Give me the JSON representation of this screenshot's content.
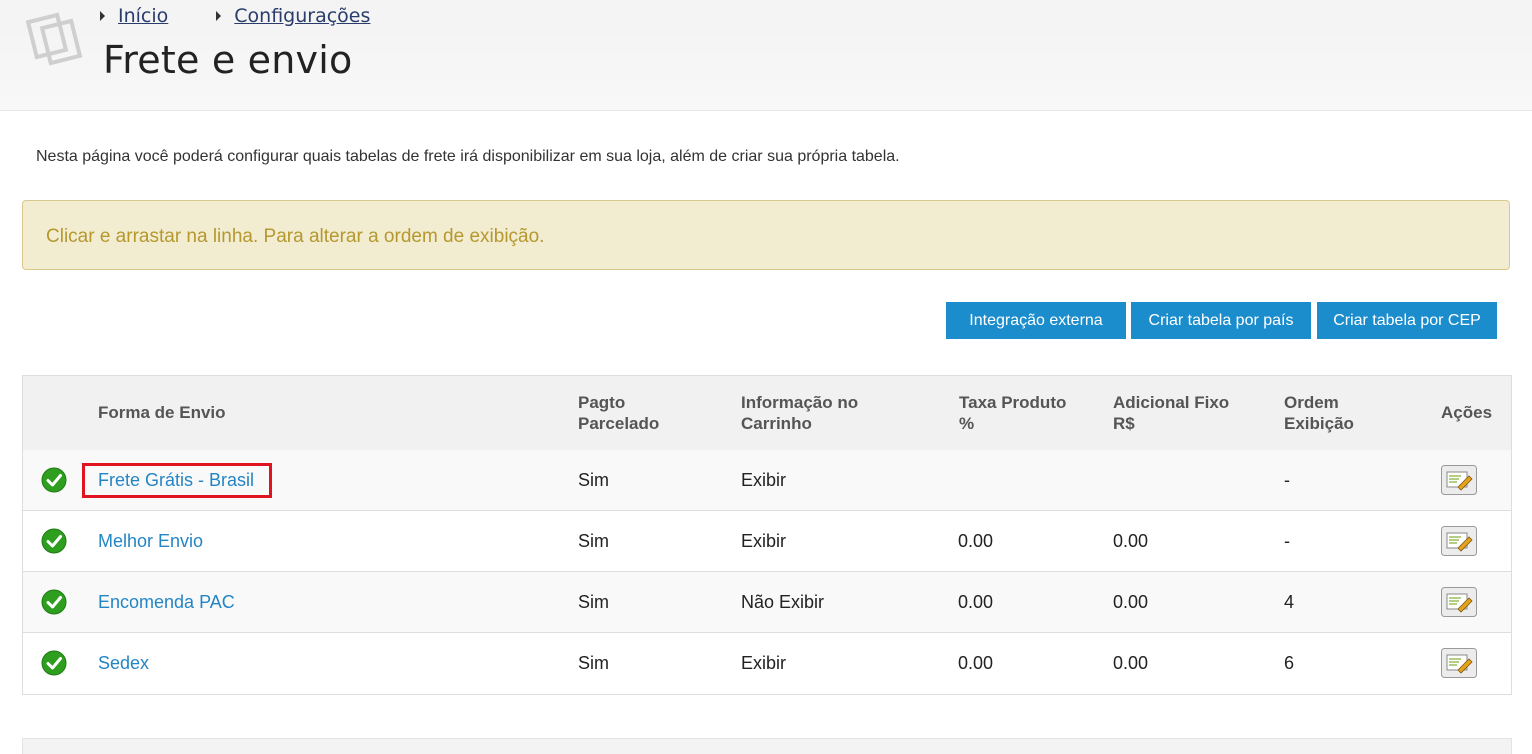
{
  "breadcrumb": [
    {
      "label": "Início"
    },
    {
      "label": "Configurações"
    }
  ],
  "page_title": "Frete e envio",
  "intro": "Nesta página você poderá configurar quais tabelas de frete irá disponibilizar em sua loja, além de criar sua própria tabela.",
  "alert": "Clicar e arrastar na linha. Para alterar a ordem de exibição.",
  "buttons": {
    "external": "Integração externa",
    "by_country": "Criar tabela por país",
    "by_cep": "Criar tabela por CEP"
  },
  "table": {
    "headers": {
      "forma": "Forma de Envio",
      "pagto_1": "Pagto",
      "pagto_2": "Parcelado",
      "info_1": "Informação no",
      "info_2": "Carrinho",
      "taxa_1": "Taxa Produto",
      "taxa_2": "%",
      "adicional_1": "Adicional Fixo",
      "adicional_2": "R$",
      "ordem_1": "Ordem",
      "ordem_2": "Exibição",
      "acoes": "Ações"
    },
    "rows": [
      {
        "status": "active",
        "name": "Frete Grátis - Brasil",
        "parcelado": "Sim",
        "info": "Exibir",
        "taxa": "",
        "adicional": "",
        "ordem": "-"
      },
      {
        "status": "active",
        "name": "Melhor Envio",
        "parcelado": "Sim",
        "info": "Exibir",
        "taxa": "0.00",
        "adicional": "0.00",
        "ordem": "-"
      },
      {
        "status": "active",
        "name": "Encomenda PAC",
        "parcelado": "Sim",
        "info": "Não Exibir",
        "taxa": "0.00",
        "adicional": "0.00",
        "ordem": "4"
      },
      {
        "status": "active",
        "name": "Sedex",
        "parcelado": "Sim",
        "info": "Exibir",
        "taxa": "0.00",
        "adicional": "0.00",
        "ordem": "6"
      }
    ]
  },
  "colors": {
    "link": "#2485c4",
    "button": "#1b8dcc",
    "alert_bg": "#f2ecd1",
    "alert_text": "#b5982e",
    "highlight": "#e0141e",
    "check": "#2e9e1f"
  },
  "icons": {
    "page": "pages-icon",
    "status": "check-circle-icon",
    "action": "edit-icon"
  }
}
